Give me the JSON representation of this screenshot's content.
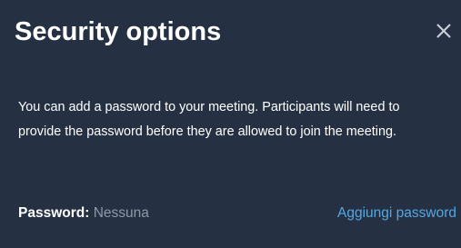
{
  "dialog": {
    "title": "Security options",
    "close_icon": "close-icon",
    "description": "You can add a password to your meeting. Participants will need to provide the password before they are allowed to join the meeting.",
    "password": {
      "label": "Password:",
      "value": "Nessuna",
      "add_link": "Aggiungi password"
    }
  },
  "colors": {
    "background": "#253143",
    "title": "#ffffff",
    "muted_value": "#8e99a8",
    "link": "#56a6e0"
  }
}
